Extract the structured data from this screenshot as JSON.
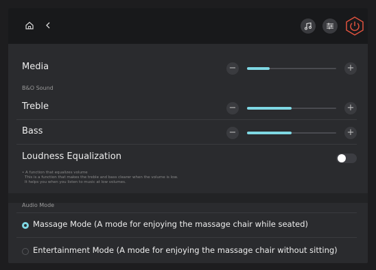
{
  "topbar": {
    "home_icon": "home-icon",
    "back_icon": "chevron-left-icon",
    "music_icon": "music-note-icon",
    "equalizer_icon": "equalizer-icon",
    "power_icon": "power-icon",
    "power_color": "#e0523e"
  },
  "media": {
    "label": "Media",
    "level": 0.25
  },
  "bo_sound": {
    "section_label": "B&O Sound",
    "treble": {
      "label": "Treble",
      "level": 0.5
    },
    "bass": {
      "label": "Bass",
      "level": 0.5
    }
  },
  "loudness": {
    "label": "Loudness Equalization",
    "enabled": false,
    "description": [
      "• A function that equalizes volume",
      "This is a function that makes the treble and bass clearer when the volume is low.",
      "It helps you when you listen to music at low volumes."
    ]
  },
  "audio_mode": {
    "section_label": "Audio Mode",
    "options": [
      {
        "label": "Massage Mode (A mode for enjoying the massage chair while seated)",
        "selected": true
      },
      {
        "label": "Entertainment Mode (A mode for enjoying the massage chair without sitting)",
        "selected": false
      }
    ]
  },
  "slider_controls": {
    "minus": "−",
    "plus": "+"
  },
  "colors": {
    "accent": "#7fd8e4",
    "background": "#2a2b2e",
    "topbar": "#18191b"
  }
}
